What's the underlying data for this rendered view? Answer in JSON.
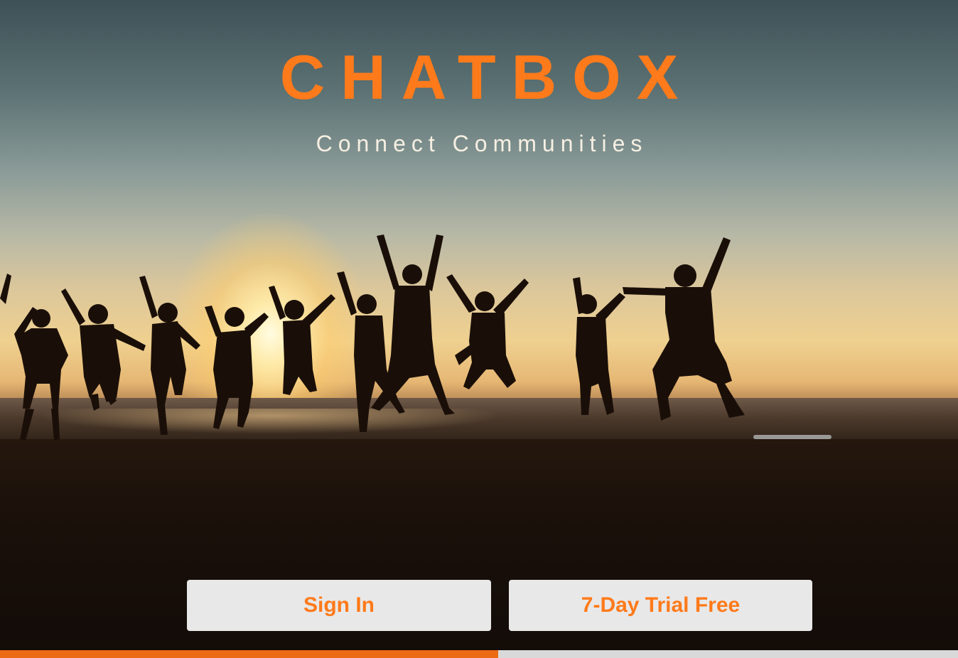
{
  "hero": {
    "brand_title": "CHATBOX",
    "tagline": "Connect Communities"
  },
  "actions": {
    "sign_in_label": "Sign In",
    "trial_label": "7-Day Trial Free"
  },
  "progress": {
    "fraction": 0.52
  },
  "colors": {
    "accent": "#ff7a1a",
    "button_bg": "#e8e8e8",
    "progress_fill": "#ec6a14",
    "progress_track": "#d9d9d9"
  }
}
